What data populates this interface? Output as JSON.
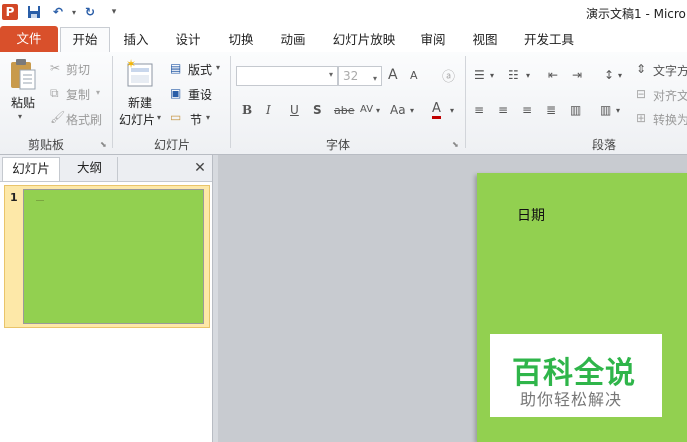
{
  "window": {
    "title": "演示文稿1 - Micro"
  },
  "quick_access": {
    "app_icon": "P",
    "save_icon": "save-icon",
    "undo_icon": "undo-icon",
    "redo_icon": "redo-icon",
    "customize_icon": "customize-icon"
  },
  "tabs": [
    "文件",
    "开始",
    "插入",
    "设计",
    "切换",
    "动画",
    "幻灯片放映",
    "审阅",
    "视图",
    "开发工具"
  ],
  "ribbon": {
    "clipboard": {
      "paste": "粘贴",
      "cut": "剪切",
      "copy": "复制",
      "format_painter": "格式刷",
      "group_label": "剪贴板"
    },
    "slides": {
      "new_slide_1": "新建",
      "new_slide_2": "幻灯片",
      "layout": "版式",
      "reset": "重设",
      "section": "节",
      "group_label": "幻灯片"
    },
    "font": {
      "font_name": "",
      "font_size": "32",
      "bold": "B",
      "italic": "I",
      "underline": "U",
      "shadow": "S",
      "strike": "abe",
      "spacing": "AV",
      "case": "Aa",
      "color": "A",
      "grow": "A",
      "shrink": "A",
      "group_label": "字体"
    },
    "paragraph": {
      "text_direction": "文字方",
      "align_text": "对齐文",
      "convert": "转换为",
      "group_label": "段落"
    }
  },
  "left_pane": {
    "tab_slides": "幻灯片",
    "tab_outline": "大纲",
    "close": "✕",
    "slide_number": "1"
  },
  "slide": {
    "date_label": "日期"
  },
  "watermark": {
    "title": "百科全说",
    "subtitle": "助你轻松解决"
  },
  "colors": {
    "file_tab": "#d9502b",
    "slide_bg": "#92d050",
    "watermark_green": "#2fb54a"
  }
}
